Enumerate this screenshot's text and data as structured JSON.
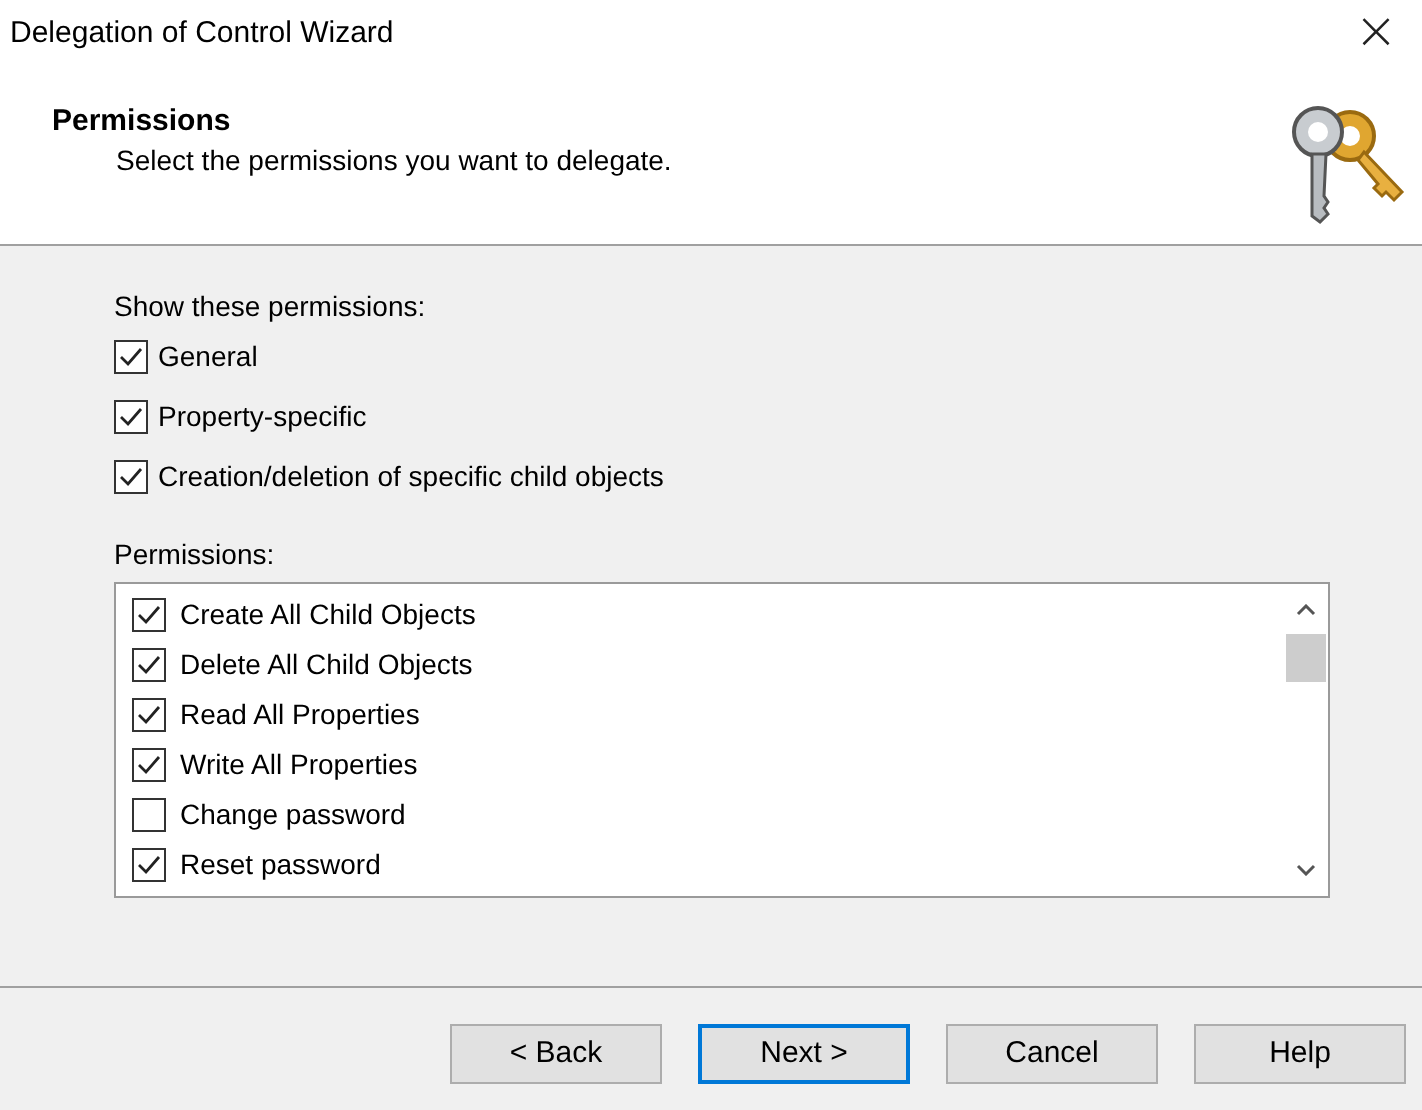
{
  "window": {
    "title": "Delegation of Control Wizard",
    "close": "×"
  },
  "header": {
    "title": "Permissions",
    "subtitle": "Select the permissions you want to delegate."
  },
  "filters": {
    "label": "Show these permissions:",
    "items": [
      {
        "label": "General",
        "checked": true
      },
      {
        "label": "Property-specific",
        "checked": true
      },
      {
        "label": "Creation/deletion of specific child objects",
        "checked": true
      }
    ]
  },
  "permissions": {
    "label": "Permissions:",
    "items": [
      {
        "label": "Create All Child Objects",
        "checked": true
      },
      {
        "label": "Delete All Child Objects",
        "checked": true
      },
      {
        "label": "Read All Properties",
        "checked": true
      },
      {
        "label": "Write All Properties",
        "checked": true
      },
      {
        "label": "Change password",
        "checked": false
      },
      {
        "label": "Reset password",
        "checked": true
      }
    ]
  },
  "buttons": [
    {
      "label": "< Back",
      "selected": false
    },
    {
      "label": "Next >",
      "selected": true
    },
    {
      "label": "Cancel",
      "selected": false
    },
    {
      "label": "Help",
      "selected": false
    }
  ]
}
